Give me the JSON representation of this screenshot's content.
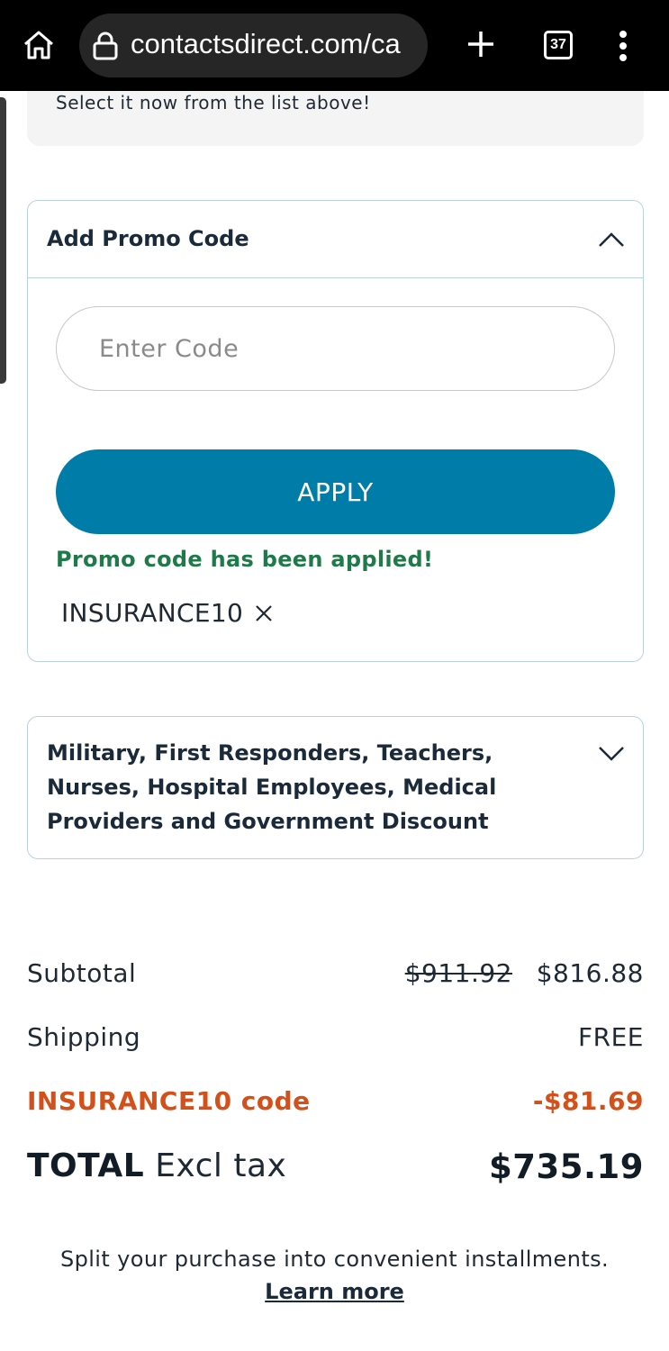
{
  "browser": {
    "url": "contactsdirect.com/ca",
    "tab_count": "37"
  },
  "notice": {
    "text": "Select it now from the list above!"
  },
  "promo": {
    "title": "Add Promo Code",
    "input_placeholder": "Enter Code",
    "apply_label": "APPLY",
    "success_message": "Promo code has been applied!",
    "applied_code": "INSURANCE10"
  },
  "discount": {
    "title": "Military, First Responders, Teachers, Nurses, Hospital Employees, Medical Providers and Government Discount"
  },
  "summary": {
    "subtotal_label": "Subtotal",
    "subtotal_original": "$911.92",
    "subtotal_value": "$816.88",
    "shipping_label": "Shipping",
    "shipping_value": "FREE",
    "code_label": "INSURANCE10 code",
    "code_value": "-$81.69",
    "total_label": "TOTAL",
    "total_suffix": "Excl tax",
    "total_value": "$735.19"
  },
  "footer": {
    "installments_text": "Split your purchase into convenient installments.",
    "learn_more": "Learn more"
  }
}
